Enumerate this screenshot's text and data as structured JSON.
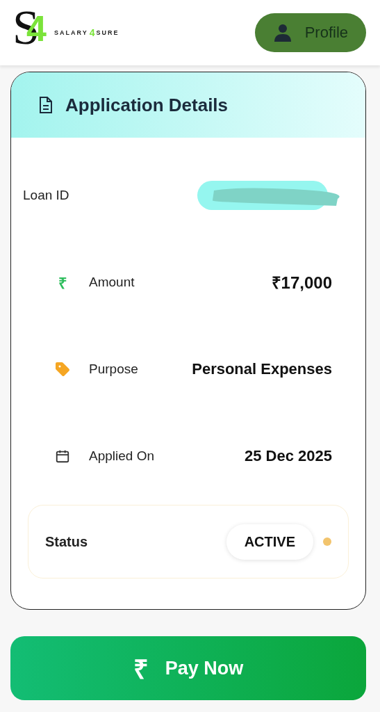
{
  "header": {
    "logo": {
      "monogram_letter": "S",
      "monogram_digit": "4",
      "word_left": "SALARY",
      "word_digit": "4",
      "word_right": "SURE"
    },
    "profile_button": "Profile"
  },
  "card": {
    "title": "Application Details",
    "rows": [
      {
        "kind": "redacted",
        "label": "Loan ID"
      },
      {
        "kind": "rupee",
        "label": "Amount",
        "value": "₹17,000"
      },
      {
        "kind": "tag",
        "label": "Purpose",
        "value": "Personal Expenses"
      },
      {
        "kind": "calendar",
        "label": "Applied On",
        "value": "25 Dec 2025"
      }
    ],
    "status": {
      "label": "Status",
      "value": "ACTIVE",
      "color": "#f2c46d"
    }
  },
  "pay_button": {
    "icon": "₹",
    "label": "Pay Now"
  }
}
